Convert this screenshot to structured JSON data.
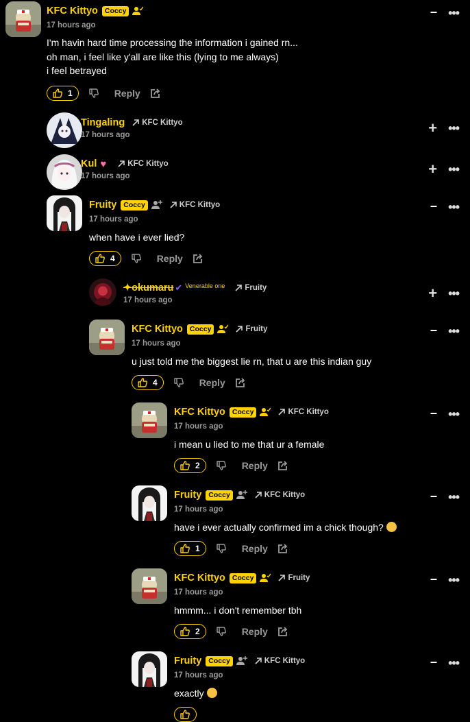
{
  "comments": [
    {
      "name": "KFC Kittyo",
      "badge": "Coccy",
      "time": "17 hours ago",
      "reply_to": "",
      "lines": [
        "I'm havin hard time processing the information i gained rn...",
        "oh man, i feel like y'all are like this (lying to me always)",
        "i feel betrayed"
      ],
      "likes": "1",
      "reply": "Reply",
      "avatar": "hamster-avatar",
      "expanded": true
    },
    {
      "name": "Tingaling",
      "badge": "",
      "time": "17 hours ago",
      "reply_to": "KFC Kittyo",
      "avatar": "blue-anime-avatar",
      "expanded": false
    },
    {
      "name": "Kul",
      "badge": "",
      "time": "17 hours ago",
      "reply_to": "KFC Kittyo",
      "avatar": "pink-anime-avatar",
      "expanded": false
    },
    {
      "name": "Fruity",
      "badge": "Coccy",
      "time": "17 hours ago",
      "reply_to": "KFC Kittyo",
      "lines": [
        "when have i ever lied?"
      ],
      "likes": "4",
      "reply": "Reply",
      "avatar": "dark-hair-avatar",
      "expanded": true
    },
    {
      "name": "✦okumaru",
      "badge": "",
      "extra": "Venerable one",
      "time": "17 hours ago",
      "reply_to": "Fruity",
      "avatar": "red-avatar",
      "expanded": false
    },
    {
      "name": "KFC Kittyo",
      "badge": "Coccy",
      "time": "17 hours ago",
      "reply_to": "Fruity",
      "lines": [
        "u just told me the biggest lie rn, that u are this indian guy"
      ],
      "likes": "4",
      "reply": "Reply",
      "avatar": "hamster-avatar",
      "expanded": true
    },
    {
      "name": "KFC Kittyo",
      "badge": "Coccy",
      "time": "17 hours ago",
      "reply_to": "KFC Kittyo",
      "lines": [
        "i mean u lied to me that ur a female"
      ],
      "likes": "2",
      "reply": "Reply",
      "avatar": "hamster-avatar",
      "expanded": true
    },
    {
      "name": "Fruity",
      "badge": "Coccy",
      "time": "17 hours ago",
      "reply_to": "KFC Kittyo",
      "lines": [
        "have i ever actually confirmed im a chick though?"
      ],
      "likes": "1",
      "reply": "Reply",
      "avatar": "dark-hair-avatar",
      "expanded": true
    },
    {
      "name": "KFC Kittyo",
      "badge": "Coccy",
      "time": "17 hours ago",
      "reply_to": "Fruity",
      "lines": [
        "hmmm... i don't remember tbh"
      ],
      "likes": "2",
      "reply": "Reply",
      "avatar": "hamster-avatar",
      "expanded": true
    },
    {
      "name": "Fruity",
      "badge": "Coccy",
      "time": "17 hours ago",
      "reply_to": "KFC Kittyo",
      "lines": [
        "exactly"
      ],
      "avatar": "dark-hair-avatar",
      "expanded": true
    }
  ],
  "controls": {
    "collapse": "−",
    "expand": "+",
    "more": "•••"
  },
  "colors": {
    "accent": "#ffd200",
    "background": "#000000",
    "muted": "#9a9a9a"
  }
}
